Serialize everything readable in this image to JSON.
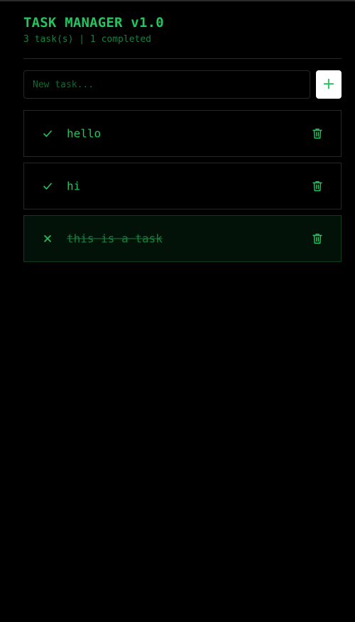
{
  "app": {
    "title": "TASK MANAGER v1.0",
    "subtitle": "3 task(s) | 1 completed"
  },
  "new_task": {
    "placeholder": "New task...",
    "value": "",
    "add_label": "+"
  },
  "tasks": [
    {
      "text": "hello",
      "completed": false,
      "toggle_icon": "check-icon",
      "delete_icon": "trash-icon"
    },
    {
      "text": "hi",
      "completed": false,
      "toggle_icon": "check-icon",
      "delete_icon": "trash-icon"
    },
    {
      "text": "this is a task",
      "completed": true,
      "toggle_icon": "x-icon",
      "delete_icon": "trash-icon"
    }
  ],
  "colors": {
    "background": "#000000",
    "accent": "#22c55e",
    "muted": "#15803d",
    "border": "#262626",
    "button_bg": "#ffffff"
  }
}
